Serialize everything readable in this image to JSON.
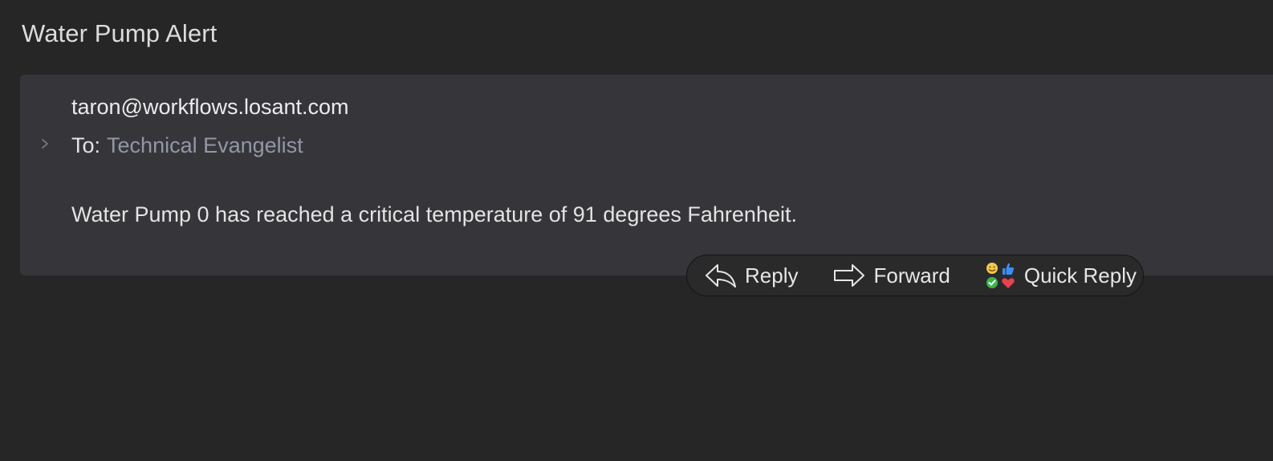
{
  "message": {
    "subject": "Water Pump Alert",
    "from": "taron@workflows.losant.com",
    "to_label": "To:",
    "to_name": "Technical Evangelist",
    "body": "Water Pump 0 has reached a critical temperature of 91 degrees Fahrenheit."
  },
  "actions": {
    "reply_label": "Reply",
    "forward_label": "Forward",
    "quick_reply_label": "Quick Reply"
  },
  "icons": {
    "expand": "chevron-right-icon",
    "reply": "reply-arrow-icon",
    "forward": "forward-arrow-icon",
    "quick_reply": "quick-reply-emoji-icon"
  },
  "colors": {
    "background": "#262627",
    "card": "#36363a",
    "recipient": "#9396a5",
    "thumbs_up": "#3b8ef0",
    "check": "#3bb54a",
    "heart": "#e8424f",
    "smiley": "#f4c84a"
  }
}
